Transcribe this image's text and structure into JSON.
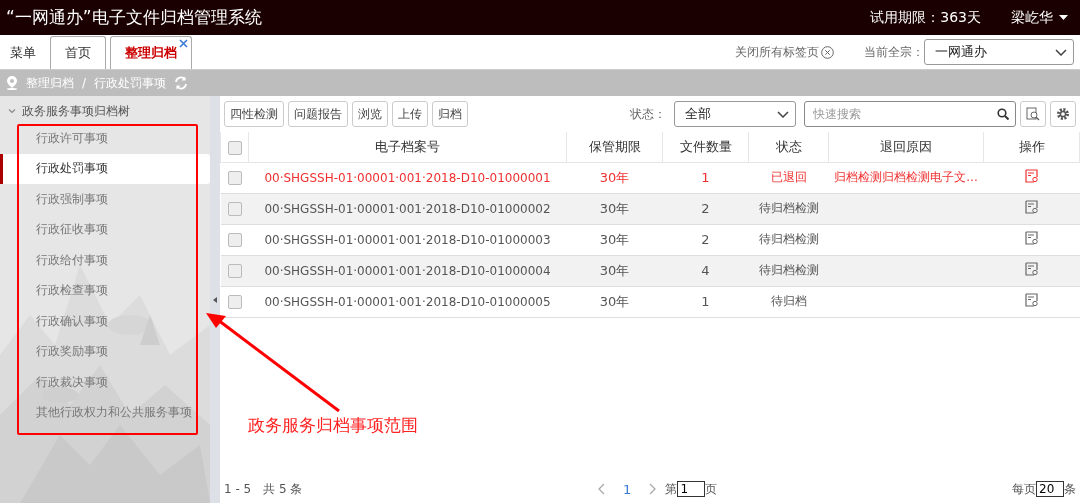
{
  "header": {
    "title": "“一网通办”电子文件归档管理系统",
    "trial": "试用期限：363天",
    "user": "梁屹华"
  },
  "tabs": [
    {
      "label": "菜单",
      "kind": "menu",
      "selected": false
    },
    {
      "label": "首页",
      "kind": "tab",
      "selected": false
    },
    {
      "label": "整理归档",
      "kind": "tab",
      "selected": true
    }
  ],
  "close_all": "关闭所有标签页",
  "fonds": {
    "label": "当前全宗：",
    "value": "一网通办"
  },
  "breadcrumb": {
    "items": [
      "整理归档",
      "行政处罚事项"
    ],
    "separator": "/"
  },
  "sidebar": {
    "title": "政务服务事项归档树",
    "expanded": true,
    "items": [
      {
        "label": "行政许可事项",
        "selected": false
      },
      {
        "label": "行政处罚事项",
        "selected": true
      },
      {
        "label": "行政强制事项",
        "selected": false
      },
      {
        "label": "行政征收事项",
        "selected": false
      },
      {
        "label": "行政给付事项",
        "selected": false
      },
      {
        "label": "行政检查事项",
        "selected": false
      },
      {
        "label": "行政确认事项",
        "selected": false
      },
      {
        "label": "行政奖励事项",
        "selected": false
      },
      {
        "label": "行政裁决事项",
        "selected": false
      },
      {
        "label": "其他行政权力和公共服务事项",
        "selected": false
      }
    ]
  },
  "toolbar": {
    "buttons": [
      "四性检测",
      "问题报告",
      "浏览",
      "上传",
      "归档"
    ],
    "status_label": "状态：",
    "status_value": "全部",
    "search_placeholder": "快速搜索"
  },
  "table": {
    "all_checked": false,
    "columns": [
      "电子档案号",
      "保管期限",
      "文件数量",
      "状态",
      "退回原因",
      "操作"
    ],
    "rows": [
      {
        "checked": false,
        "returned": true,
        "number": "00·SHGSSH-01·00001·001·2018-D10-01000001",
        "period": "30年",
        "count": "1",
        "status": "已退回",
        "reason": "归档检测归档检测电子文..."
      },
      {
        "checked": false,
        "returned": false,
        "number": "00·SHGSSH-01·00001·001·2018-D10-01000002",
        "period": "30年",
        "count": "2",
        "status": "待归档检测"
      },
      {
        "checked": false,
        "returned": false,
        "number": "00·SHGSSH-01·00001·001·2018-D10-01000003",
        "period": "30年",
        "count": "2",
        "status": "待归档检测"
      },
      {
        "checked": false,
        "returned": false,
        "number": "00·SHGSSH-01·00001·001·2018-D10-01000004",
        "period": "30年",
        "count": "4",
        "status": "待归档检测"
      },
      {
        "checked": false,
        "returned": false,
        "number": "00·SHGSSH-01·00001·001·2018-D10-01000005",
        "period": "30年",
        "count": "1",
        "status": "待归档"
      }
    ]
  },
  "pagination": {
    "range": "1 - 5",
    "total": "共 5 条",
    "page": "1",
    "goto_prefix": "第",
    "goto_value": "1",
    "goto_suffix": "页",
    "per_page_prefix": "每页",
    "per_page_value": "20",
    "per_page_suffix": "条"
  },
  "annotation": {
    "label": "政务服务归档事项范围"
  }
}
